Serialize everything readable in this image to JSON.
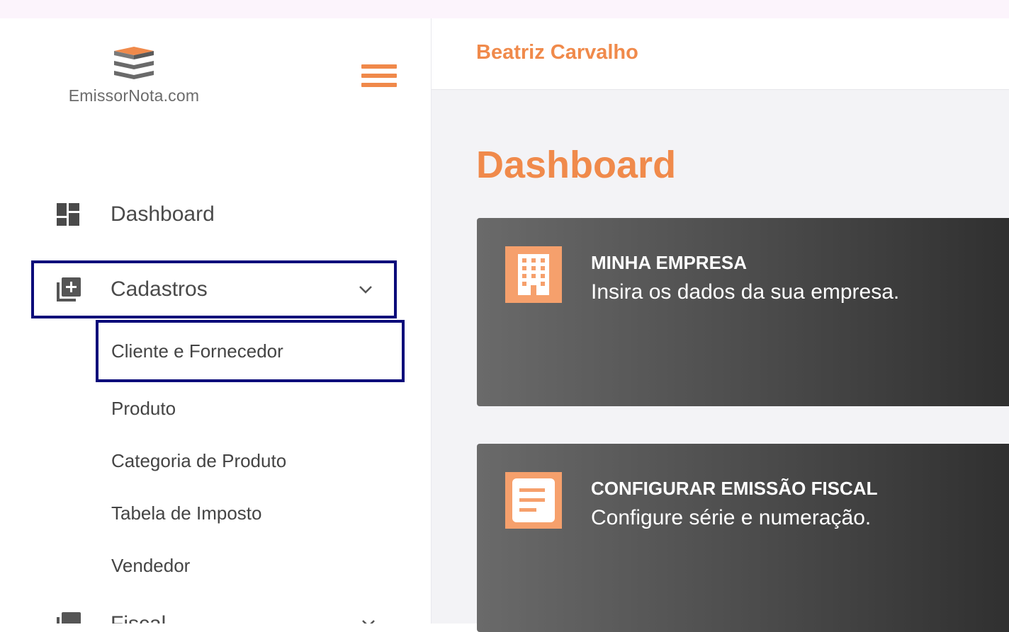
{
  "brand": {
    "logo_text": "EmissorNota.com"
  },
  "sidebar": {
    "items": [
      {
        "label": "Dashboard"
      },
      {
        "label": "Cadastros"
      },
      {
        "label": "Fiscal"
      }
    ],
    "cadastros_sub": [
      {
        "label": "Cliente e Fornecedor"
      },
      {
        "label": "Produto"
      },
      {
        "label": "Categoria de Produto"
      },
      {
        "label": "Tabela de Imposto"
      },
      {
        "label": "Vendedor"
      }
    ]
  },
  "header": {
    "user_name": "Beatriz Carvalho"
  },
  "main": {
    "title": "Dashboard",
    "cards": [
      {
        "title": "MINHA EMPRESA",
        "description": "Insira os dados da sua empresa."
      },
      {
        "title": "CONFIGURAR EMISSÃO FISCAL",
        "description": "Configure série e numeração."
      }
    ]
  },
  "colors": {
    "accent": "#f08a4b",
    "card_icon_bg": "#f6a06c",
    "highlight_border": "#0a0a7a"
  }
}
